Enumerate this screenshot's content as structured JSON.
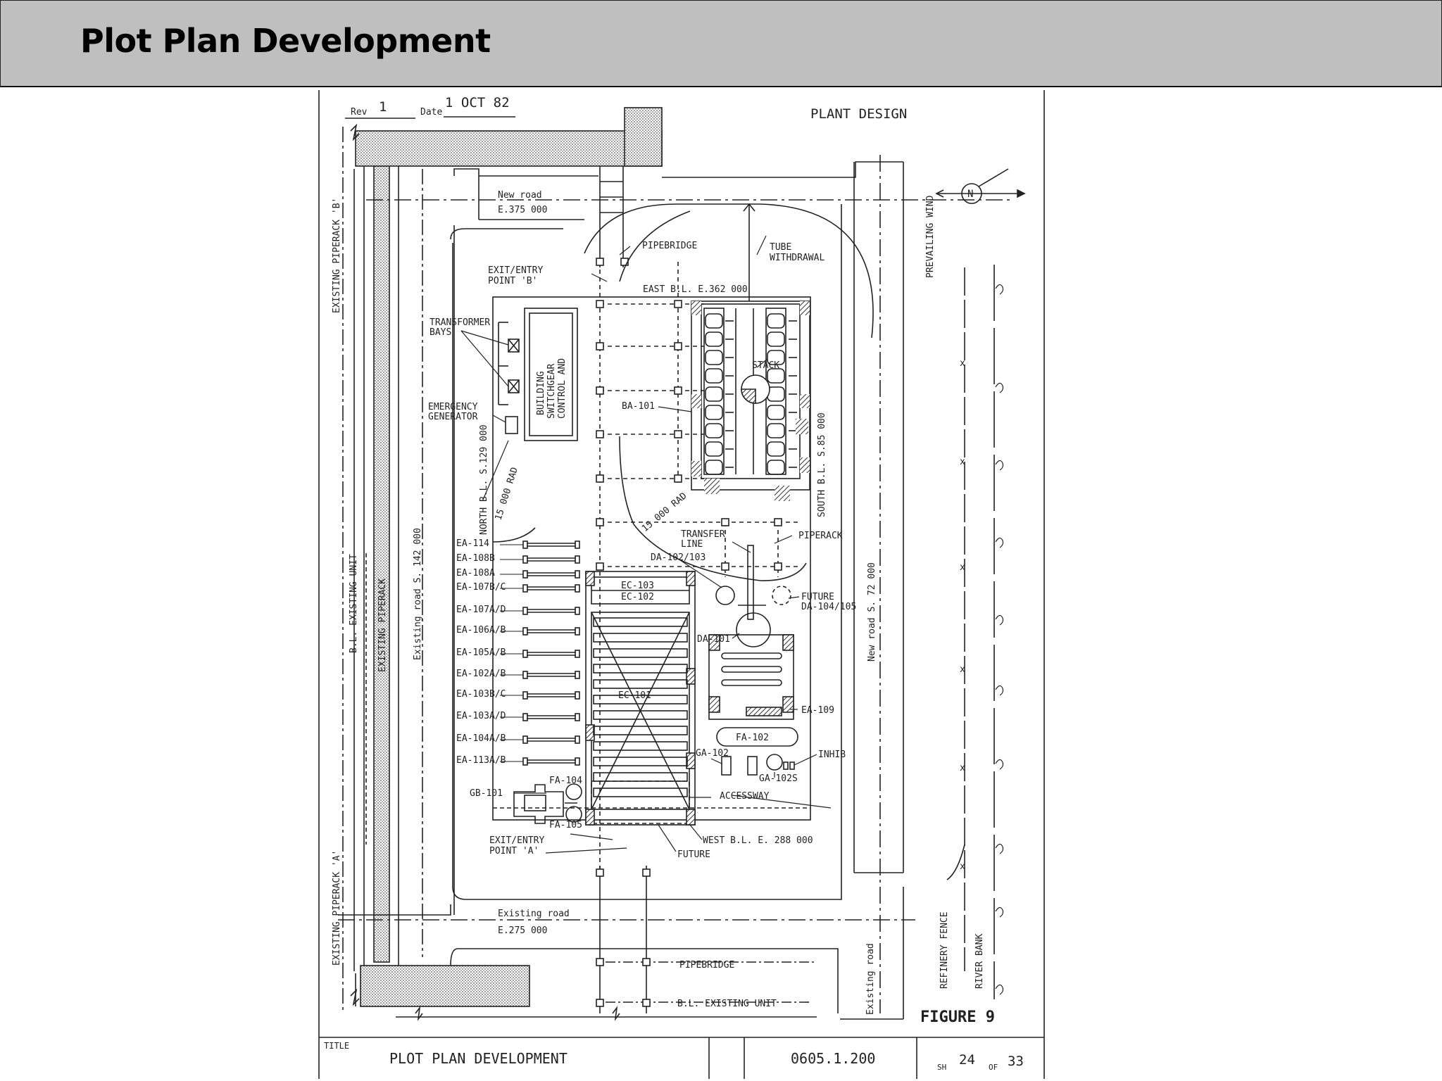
{
  "header": {
    "title": "Plot Plan Development"
  },
  "sheet": {
    "rev_label": "Rev",
    "rev": "1",
    "date_label": "Date",
    "date": "1 OCT 82",
    "company": "PLANT DESIGN",
    "figure": "FIGURE 9",
    "title_label": "TITLE",
    "title": "PLOT PLAN DEVELOPMENT",
    "drawing_no": "0605.1.200",
    "sh_label": "SH",
    "sheet_no": "24",
    "of_label": "OF",
    "sheet_total": "33"
  },
  "labels": {
    "new_road_top": "New road",
    "new_road_top_e": "E.375 000",
    "pipebridge_top": "PIPEBRIDGE",
    "tube_withdrawal_1": "TUBE",
    "tube_withdrawal_2": "WITHDRAWAL",
    "exit_b_1": "EXIT/ENTRY",
    "exit_b_2": "POINT 'B'",
    "east_bl": "EAST B.L. E.362 000",
    "transformer_1": "TRANSFORMER",
    "transformer_2": "BAYS",
    "control_building": "CONTROL AND",
    "switchgear": "SWITCHGEAR",
    "building": "BUILDING",
    "stack": "STACK",
    "ba101": "BA-101",
    "emergency_1": "EMERGENCY",
    "emergency_2": "GENERATOR",
    "north_bl": "NORTH B.L. S.129 000",
    "rad_left": "15 000 RAD",
    "rad_mid": "15 000 RAD",
    "south_bl": "SOUTH B.L. S.85 000",
    "transfer_1": "TRANSFER",
    "transfer_2": "LINE",
    "piperack": "PIPERACK",
    "da102": "DA-102/103",
    "ec103": "EC-103",
    "ec102": "EC-102",
    "future_1": "FUTURE",
    "future_2": "DA-104/105",
    "da101": "DA-101",
    "ec101": "EC-101",
    "ea109": "EA-109",
    "fa102": "FA-102",
    "ga102": "GA-102",
    "inhib": "INHIB",
    "ga102s": "GA-102S",
    "accessway": "ACCESSWAY",
    "gb101": "GB-101",
    "fa104": "FA-104",
    "fa105": "FA-105",
    "exit_a_1": "EXIT/ENTRY",
    "exit_a_2": "POINT 'A'",
    "west_bl": "WEST B.L. E. 288 000",
    "future_bottom": "FUTURE",
    "existing_road": "Existing road",
    "existing_road_e": "E.275 000",
    "pipebridge_bottom": "PIPEBRIDGE",
    "bl_existing_unit_bottom": "B.L. EXISTING UNIT",
    "existing_piperack_b": "EXISTING PIPERACK 'B'",
    "existing_piperack_a": "EXISTING PIPERACK 'A'",
    "bl_existing_unit_left": "B.L. EXISTING UNIT",
    "existing_piperack": "EXISTING PIPERACK",
    "existing_road_s": "Existing road S. 142 000",
    "new_road_s": "New road S. 72 000",
    "existing_road_right": "Existing road",
    "prevailing_wind": "PREVAILING WIND",
    "refinery_fence": "REFINERY FENCE",
    "river_bank": "RIVER BANK",
    "north_symbol": "N"
  },
  "ea_labels": [
    "EA-114",
    "EA-108B",
    "EA-108A",
    "EA-107B/C",
    "EA-107A/D",
    "EA-106A/B",
    "EA-105A/B",
    "EA-102A/B",
    "EA-103B/C",
    "EA-103A/D",
    "EA-104A/B",
    "EA-113A/B"
  ]
}
